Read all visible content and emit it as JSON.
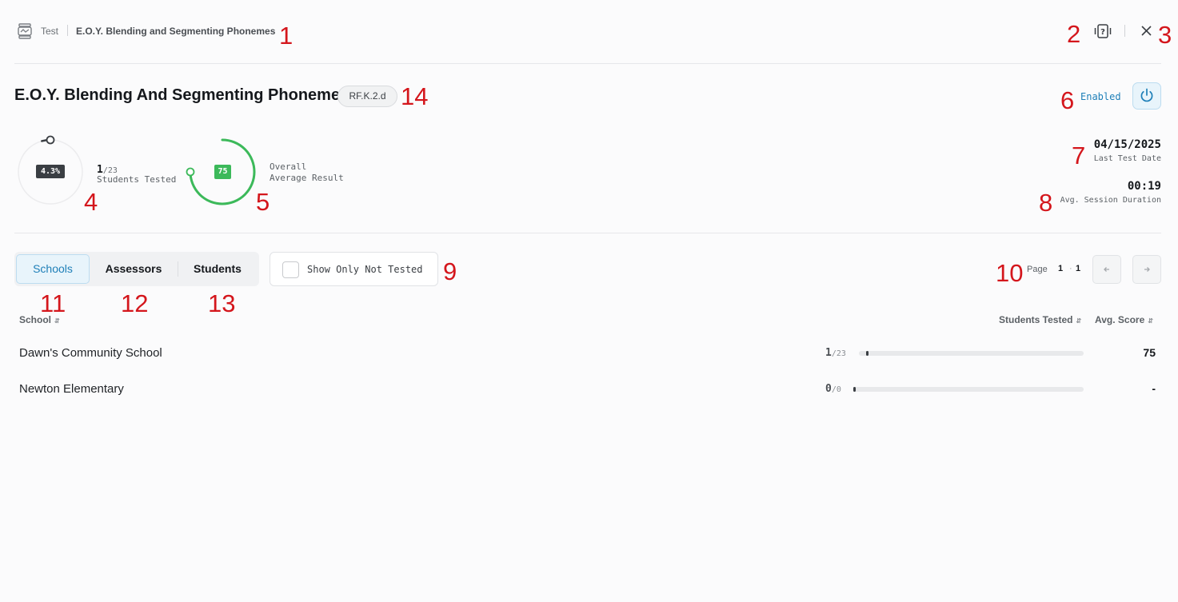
{
  "header": {
    "breadcrumb_parent": "Test",
    "breadcrumb_current": "E.O.Y. Blending and Segmenting Phonemes",
    "help_icon": "help-question-icon",
    "close_icon": "close-icon"
  },
  "assessment": {
    "title": "E.O.Y. Blending And Segmenting Phonemes",
    "standard": "RF.K.2.d",
    "status": "Enabled",
    "power_icon": "power-icon"
  },
  "stats": {
    "tested_percent": "4.3%",
    "tested_fraction": 0.043,
    "tested_count": "1",
    "tested_total": "/23",
    "tested_label": "Students Tested",
    "avg_result": "75",
    "avg_fraction": 0.75,
    "avg_label_1": "Overall",
    "avg_label_2": "Average Result",
    "last_test_date": "04/15/2025",
    "last_test_label": "Last Test Date",
    "session_duration": "00:19",
    "session_label": "Avg. Session Duration"
  },
  "tabs": [
    {
      "label": "Schools",
      "active": true
    },
    {
      "label": "Assessors",
      "active": false
    },
    {
      "label": "Students",
      "active": false
    }
  ],
  "filter": {
    "label": "Show Only Not Tested",
    "checked": false
  },
  "pagination": {
    "label": "Page",
    "current": "1",
    "separator": "·",
    "total": "1",
    "prev_icon": "arrow-left-icon",
    "next_icon": "arrow-right-icon"
  },
  "table": {
    "columns": {
      "school": "School",
      "students_tested": "Students Tested",
      "avg_score": "Avg. Score"
    },
    "rows": [
      {
        "school": "Dawn's Community School",
        "tested": "1",
        "total": "/23",
        "fraction": 0.043,
        "score": "75"
      },
      {
        "school": "Newton Elementary",
        "tested": "0",
        "total": "/0",
        "fraction": 0,
        "score": "-"
      }
    ]
  },
  "annotations": [
    "1",
    "2",
    "3",
    "4",
    "5",
    "6",
    "7",
    "8",
    "9",
    "10",
    "11",
    "12",
    "13",
    "14"
  ],
  "colors": {
    "accent": "#1e7fb8",
    "success": "#3cb95a",
    "dark": "#3a3e43",
    "annotation": "#d4161c"
  }
}
